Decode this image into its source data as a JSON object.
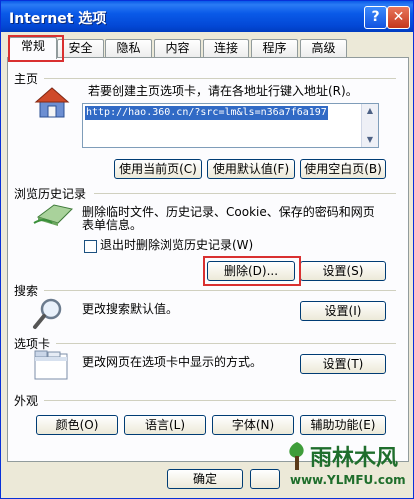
{
  "window": {
    "title": "Internet 选项",
    "help_glyph": "?",
    "close_glyph": "✕"
  },
  "tabs": [
    "常规",
    "安全",
    "隐私",
    "内容",
    "连接",
    "程序",
    "高级"
  ],
  "home": {
    "section": "主页",
    "desc": "若要创建主页选项卡，请在各地址行键入地址(R)。",
    "url": "http://hao.360.cn/?src=lm&ls=n36a7f6a197",
    "buttons": [
      "使用当前页(C)",
      "使用默认值(F)",
      "使用空白页(B)"
    ]
  },
  "history": {
    "section": "浏览历史记录",
    "desc_line1": "删除临时文件、历史记录、Cookie、保存的密码和网页",
    "desc_line2": "表单信息。",
    "checkbox_label": "退出时删除浏览历史记录(W)",
    "checkbox_checked": false,
    "delete_button": "删除(D)...",
    "settings_button": "设置(S)"
  },
  "search": {
    "section": "搜索",
    "desc": "更改搜索默认值。",
    "settings_button": "设置(I)"
  },
  "tabs_section": {
    "section": "选项卡",
    "desc": "更改网页在选项卡中显示的方式。",
    "settings_button": "设置(T)"
  },
  "appearance": {
    "section": "外观",
    "buttons": [
      "颜色(O)",
      "语言(L)",
      "字体(N)",
      "辅助功能(E)"
    ]
  },
  "footer": {
    "ok_button": "确定"
  },
  "watermark": {
    "brand": "雨林木风",
    "url": "www.YLMFU.com"
  },
  "icons": [
    "house-icon",
    "eraser-icon",
    "magnifier-icon",
    "tabs-window-icon",
    "tree-logo-icon"
  ]
}
